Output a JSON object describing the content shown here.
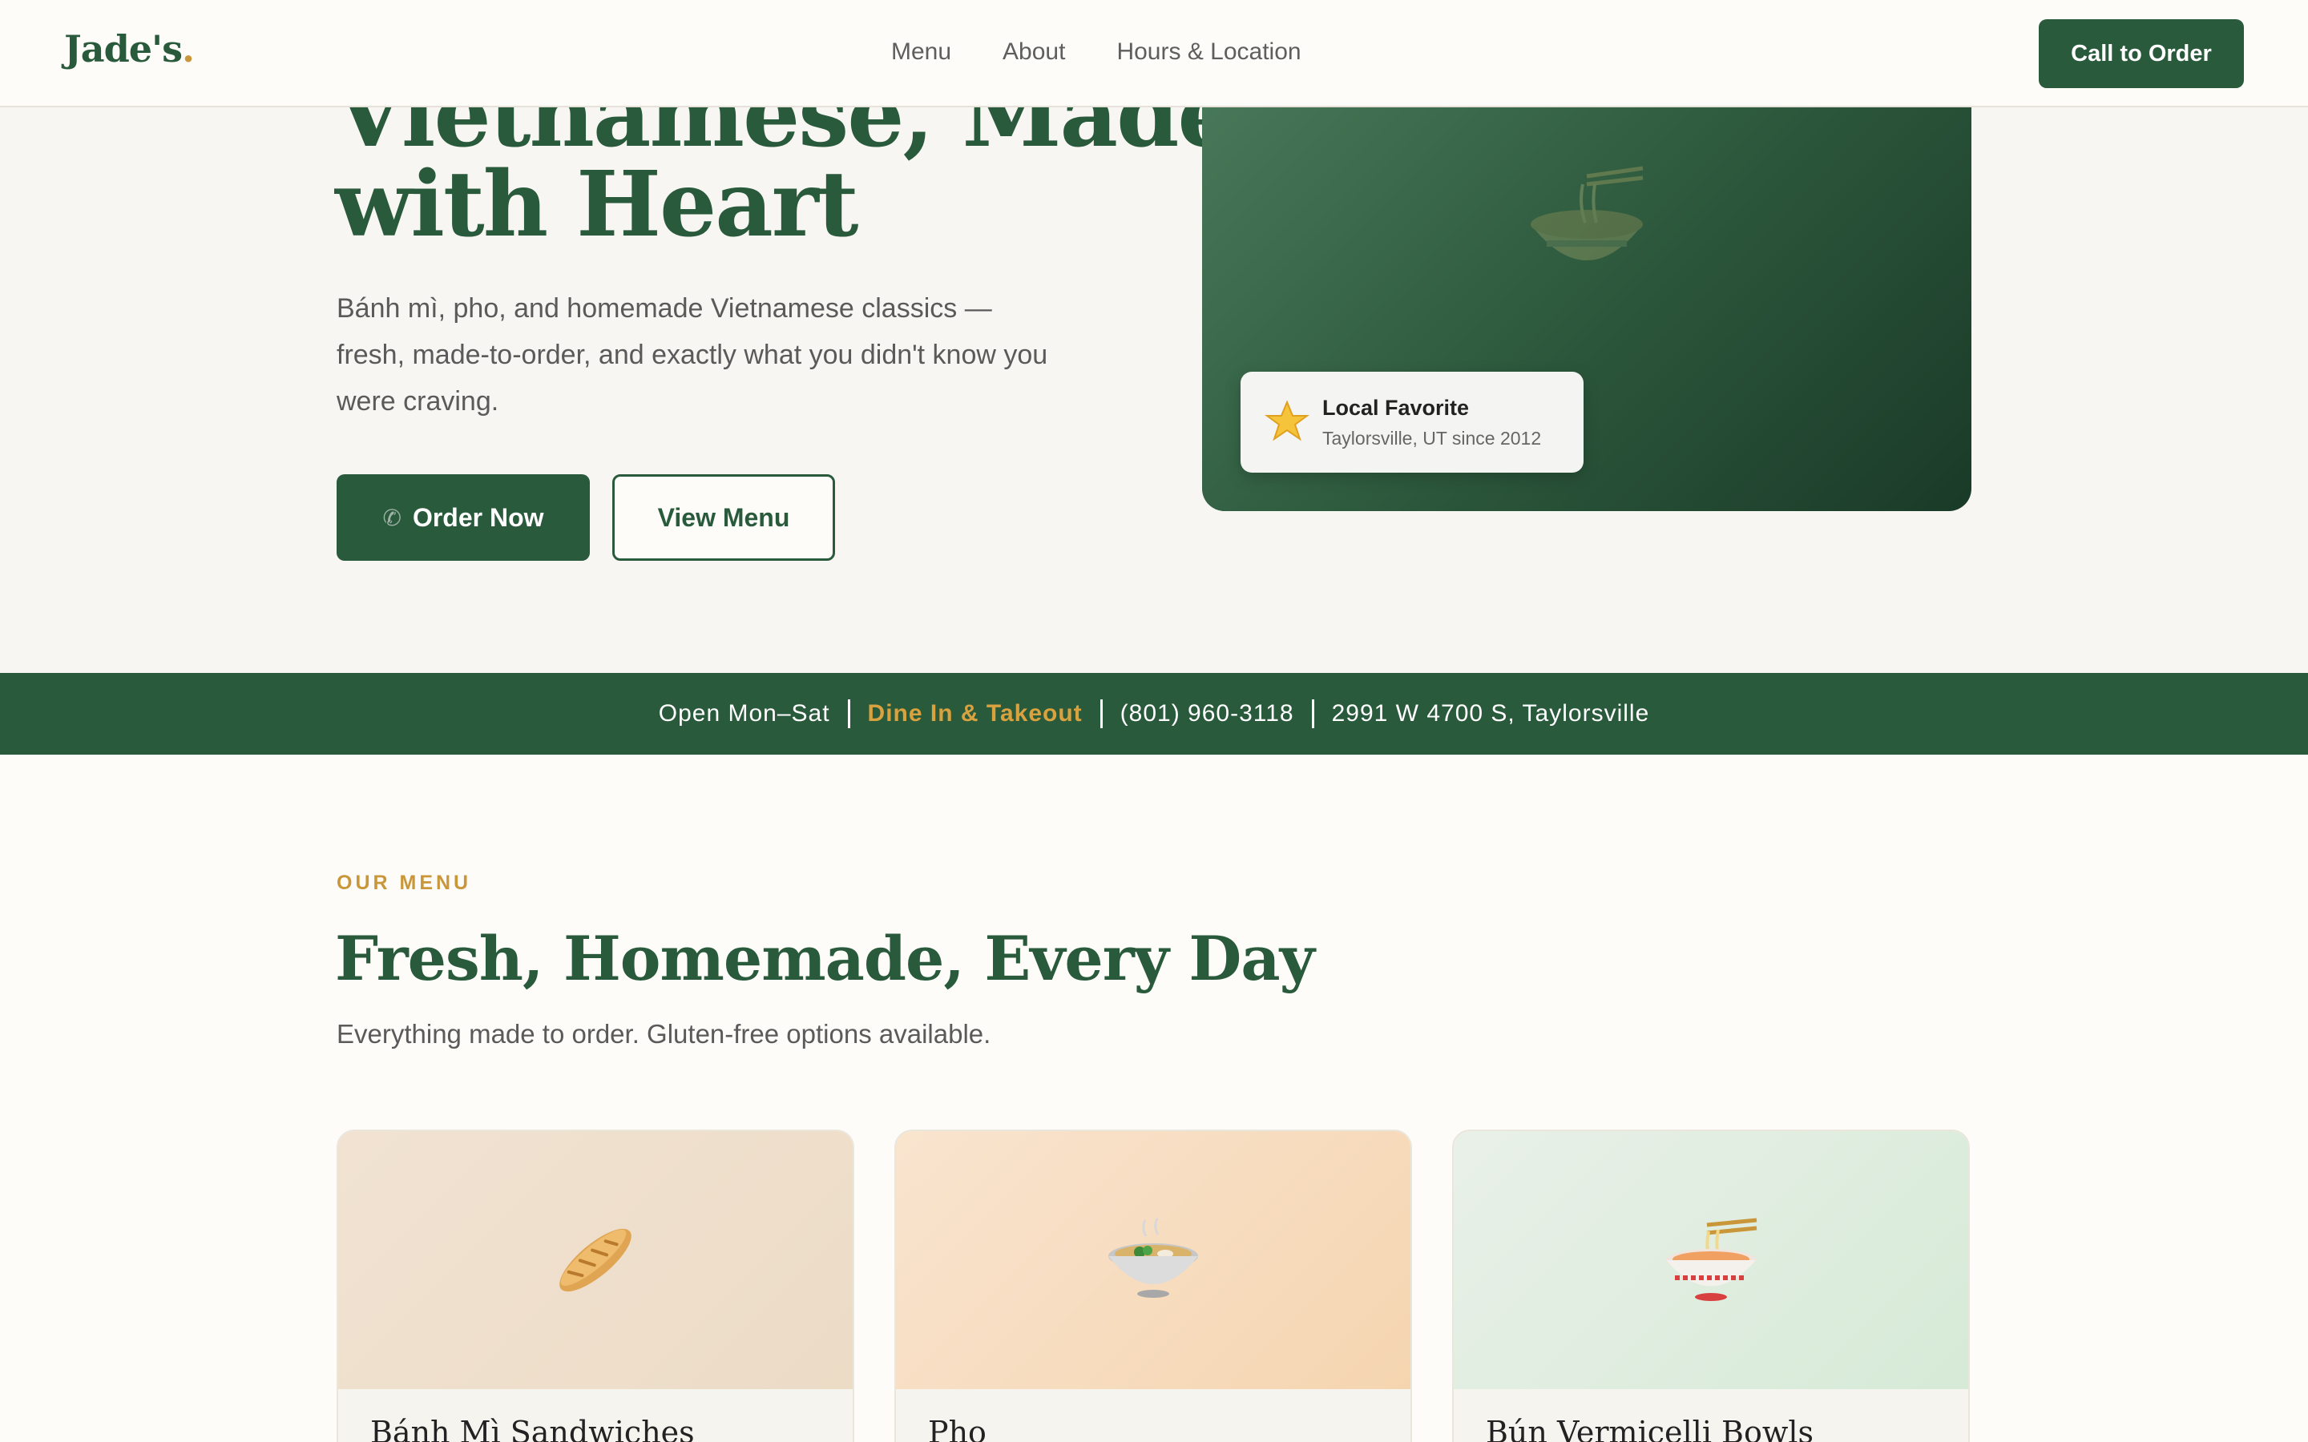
{
  "header": {
    "logo": "Jade's",
    "logo_dot": ".",
    "nav": [
      "Menu",
      "About",
      "Hours & Location"
    ],
    "cta": "Call to Order"
  },
  "hero": {
    "title_line1": "Vietnamese, Made",
    "title_line2": "with Heart",
    "subtitle": "Bánh mì, pho, and homemade Vietnamese classics — fresh, made-to-order, and exactly what you didn't know you were craving.",
    "order_button": "Order Now",
    "menu_button": "View Menu",
    "badge_title": "Local Favorite",
    "badge_subtitle": "Taylorsville, UT since 2012"
  },
  "infobar": {
    "hours": "Open Mon–Sat",
    "service": "Dine In & Takeout",
    "phone": "(801) 960-3118",
    "address": "2991 W 4700 S, Taylorsville"
  },
  "menu": {
    "eyebrow": "OUR MENU",
    "title": "Fresh, Homemade, Every Day",
    "subtitle": "Everything made to order. Gluten-free options available.",
    "cards": [
      {
        "name": "Bánh Mì Sandwiches",
        "icon": "baguette-icon"
      },
      {
        "name": "Pho",
        "icon": "soup-bowl-icon"
      },
      {
        "name": "Bún Vermicelli Bowls",
        "icon": "noodle-bowl-icon"
      }
    ]
  },
  "colors": {
    "brand_green": "#2a5a3c",
    "accent_gold": "#c9973a"
  }
}
